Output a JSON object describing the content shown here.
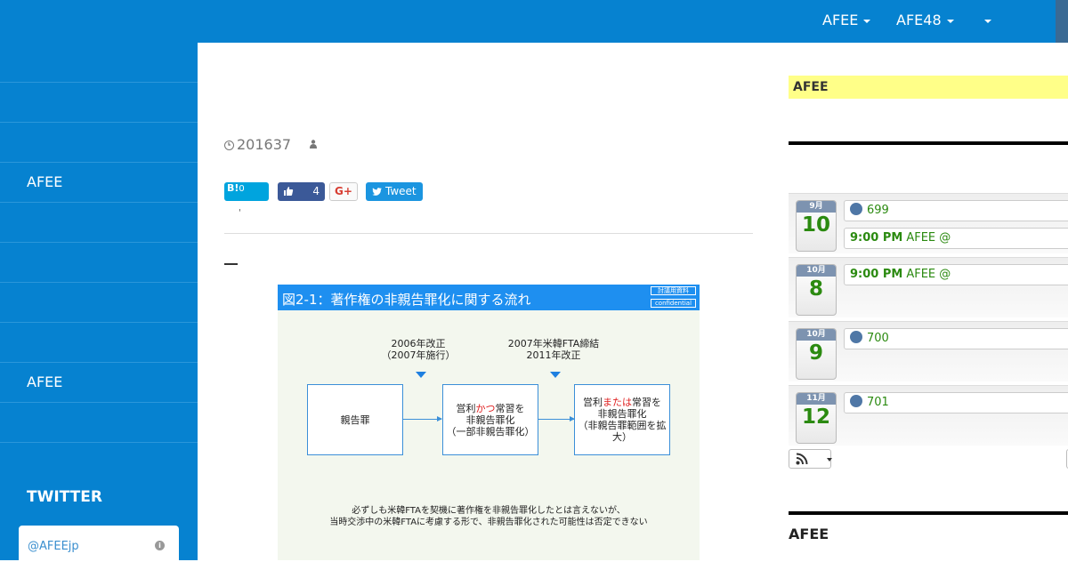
{
  "topnav": {
    "items": [
      {
        "label": "AFEE"
      },
      {
        "label": "AFE48"
      },
      {
        "label": ""
      }
    ]
  },
  "sidebar": {
    "items": [
      "",
      "",
      "",
      "AFEE",
      "",
      "",
      "",
      "",
      "AFEE",
      ""
    ],
    "twitter_title": "TWITTER",
    "twitter_handle": "@AFEEjp",
    "info_glyph": "i"
  },
  "post": {
    "date": "201637",
    "share": {
      "hatena": "B!",
      "hatena_count": "0",
      "fb_count": "4",
      "gplus": "G+",
      "tweet": "Tweet"
    },
    "snippet": "'"
  },
  "slide": {
    "title": "図2-1：著作権の非親告罪化に関する流れ",
    "tag1": "討議用資料",
    "tag2": "confidential",
    "note1_line1": "2006年改正",
    "note1_line2": "（2007年施行）",
    "note2_line1": "2007年米韓FTA締結",
    "note2_line2": "2011年改正",
    "box1": "親告罪",
    "box2_l1a": "営利",
    "box2_l1red": "かつ",
    "box2_l1b": "常習を",
    "box2_l2": "非親告罪化",
    "box2_l3": "（一部非親告罪化）",
    "box3_l1a": "営利",
    "box3_l1red": "または",
    "box3_l1b": "常習を",
    "box3_l2": "非親告罪化",
    "box3_l3": "（非親告罪範囲を拡大）",
    "footer1": "必ずしも米韓FTAを契機に著作権を非親告罪化したとは言えないが、",
    "footer2": "当時交渉中の米韓FTAに考慮する形で、非親告罪化された可能性は否定できない"
  },
  "right": {
    "yellow_title": "AFEE",
    "events": [
      {
        "month": "9月",
        "day": "10",
        "entries": [
          {
            "dot": true,
            "time": "",
            "text": "699"
          },
          {
            "dot": false,
            "time": "9:00 PM",
            "text": "AFEE          @"
          }
        ]
      },
      {
        "month": "10月",
        "day": "8",
        "entries": [
          {
            "dot": false,
            "time": "9:00 PM",
            "text": "AFEE          @"
          }
        ]
      },
      {
        "month": "10月",
        "day": "9",
        "entries": [
          {
            "dot": true,
            "time": "",
            "text": "700"
          }
        ]
      },
      {
        "month": "11月",
        "day": "12",
        "entries": [
          {
            "dot": true,
            "time": "",
            "text": "701"
          }
        ]
      }
    ],
    "bottom_title": "AFEE"
  },
  "colors": {
    "brand_blue": "#0682d0",
    "event_green": "#2b8a10",
    "highlight_yellow": "#ffff88"
  }
}
